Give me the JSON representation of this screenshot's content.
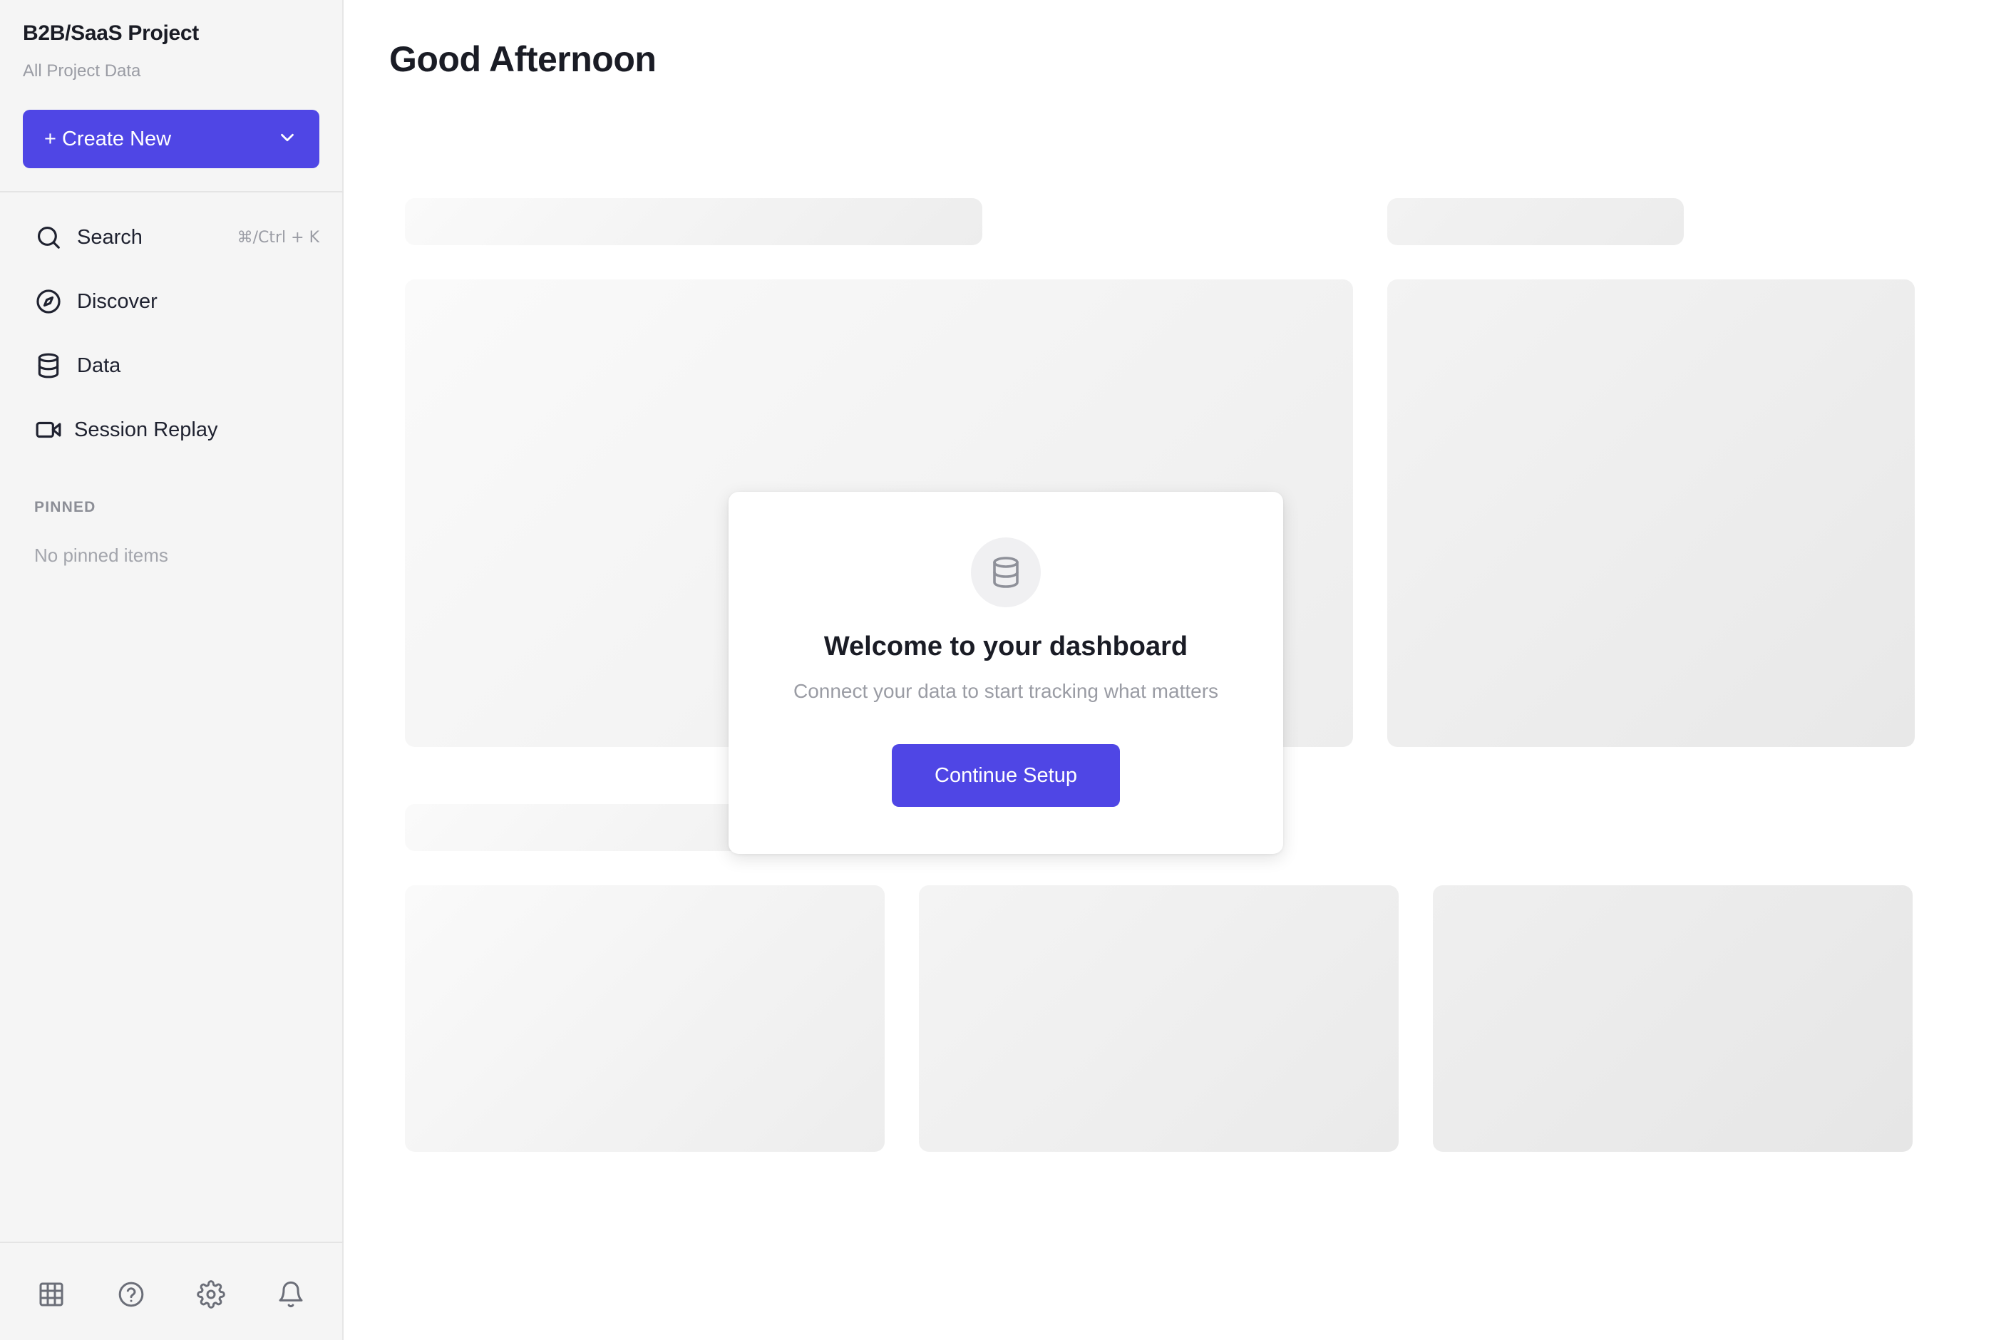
{
  "colors": {
    "accent": "#4f46e5",
    "sidebar_bg": "#f5f5f5",
    "muted_text": "#9a9ca4"
  },
  "sidebar": {
    "project_title": "B2B/SaaS Project",
    "project_subtitle": "All Project Data",
    "create_button": {
      "label": "+ Create New",
      "icon": "chevron-down-icon"
    },
    "nav": [
      {
        "label": "Search",
        "icon": "search-icon",
        "shortcut": "⌘/Ctrl + K"
      },
      {
        "label": "Discover",
        "icon": "compass-icon"
      },
      {
        "label": "Data",
        "icon": "database-icon"
      },
      {
        "label": "Session Replay",
        "icon": "video-icon"
      }
    ],
    "pinned": {
      "heading": "PINNED",
      "empty_text": "No pinned items"
    },
    "bottom_icons": [
      "grid-icon",
      "help-icon",
      "settings-icon",
      "bell-icon"
    ]
  },
  "main": {
    "greeting": "Good Afternoon"
  },
  "modal": {
    "icon": "database-icon",
    "title": "Welcome to your dashboard",
    "subtitle": "Connect your data to start tracking what matters",
    "button_label": "Continue Setup"
  }
}
